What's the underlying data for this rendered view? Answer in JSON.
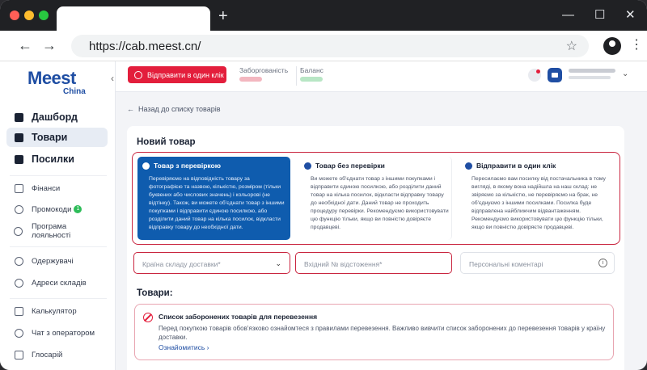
{
  "browser": {
    "url": "https://cab.meest.cn/",
    "new_tab": "+",
    "minimize": "—",
    "maximize": "☐",
    "close": "✕",
    "back": "←",
    "forward": "→",
    "star": "☆",
    "menu": "⋮"
  },
  "logo": {
    "brand": "Meest",
    "sub": "China"
  },
  "sidebar": {
    "collapse": "‹",
    "items": [
      {
        "label": "Дашборд"
      },
      {
        "label": "Товари"
      },
      {
        "label": "Посилки"
      },
      {
        "label": "Фінанси"
      },
      {
        "label": "Промокоди",
        "badge": "1"
      },
      {
        "label": "Програма лояльності"
      },
      {
        "label": "Одержувачі"
      },
      {
        "label": "Адреси складів"
      },
      {
        "label": "Калькулятор"
      },
      {
        "label": "Чат з оператором"
      },
      {
        "label": "Глосарій"
      }
    ]
  },
  "header": {
    "send_button": "Відправити в один клік",
    "debt_label": "Заборгованість",
    "balance_label": "Баланс",
    "chevron": "⌄"
  },
  "content": {
    "back_link": "Назад до списку товарів",
    "card_title": "Новий товар",
    "options": [
      {
        "title": "Товар з перевіркою",
        "text": "Перевіряємо на відповідність товару за фотографією та назвою, кількістю, розміром (тільки буквених або числових значень) і кольорові (не відтінку). Також, ви можете об'єднати товар з іншими покупками і відправити єдиною посилкою, або розділити даний товар на кілька посилок, відкласти відправку товару до необхідної дати."
      },
      {
        "title": "Товар без перевірки",
        "text": "Ви можете об'єднати товар з іншими покупками і відправити єдиною посилкою, або розділити даний товар на кілька посилок, відкласти відправку товару до необхідної дати. Даний товар не проходить процедуру перевірки. Рекомендуємо використовувати цю функцію тільки, якщо ви повністю довіряєте продавцеві."
      },
      {
        "title": "Відправити в один клік",
        "text": "Пересилаємо вам посилку від постачальника в тому вигляді, в якому вона надійшла на наш склад: не звіряємо за кількістю, не перевіряємо на брак, не об'єднуємо з іншими посилками. Посилка буде відправлена найближчим відвантаженням. Рекомендуємо використовувати цю функцію тільки, якщо ви повністю довіряєте продавцеві."
      }
    ],
    "fields": {
      "country_placeholder": "Країна складу доставки*",
      "tracking_placeholder": "Вхідний № відстоження*",
      "comments_placeholder": "Персональні коментарі",
      "chevron": "⌄",
      "info": "i"
    },
    "goods_title": "Товари:",
    "warning": {
      "title": "Список заборонених товарів для перевезення",
      "text": "Перед покупкою товарів обов'язково ознайомтеся з правилами перевезення. Важливо вивчити список заборонених до перевезення товарів у країну доставки.",
      "link": "Ознайомитись  ›"
    }
  },
  "colors": {
    "brand_blue": "#1f4ea3",
    "brand_red": "#e31e3c",
    "selected_option": "#0f5cae"
  }
}
